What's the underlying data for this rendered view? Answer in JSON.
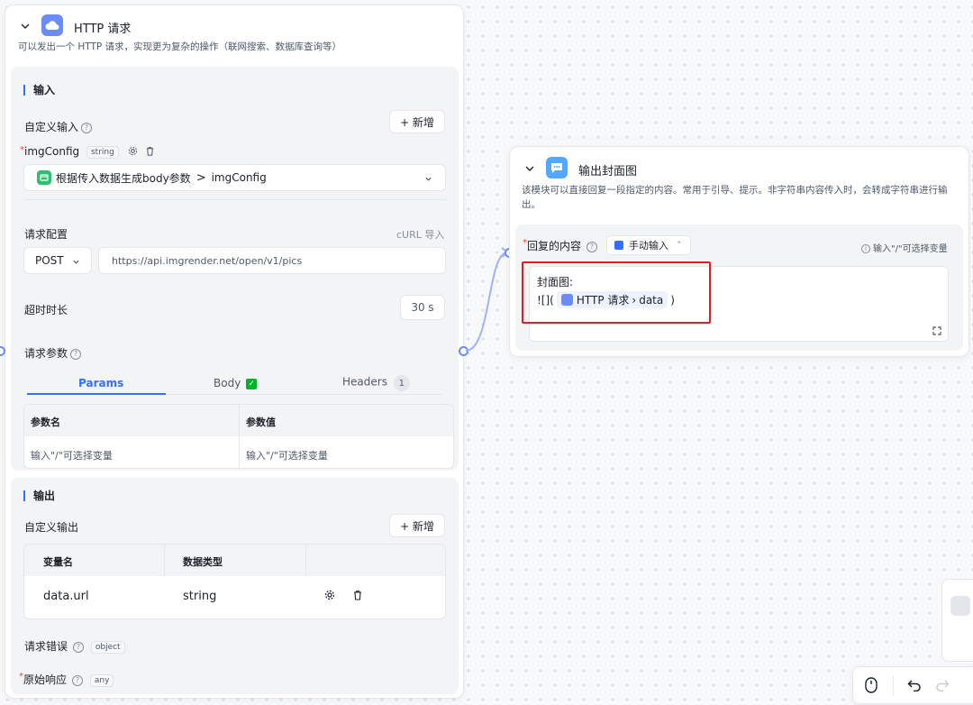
{
  "http_node": {
    "title": "HTTP 请求",
    "description": "可以发出一个 HTTP 请求，实现更为复杂的操作（联网搜索、数据库查询等）",
    "input_section": {
      "title": "输入",
      "custom_input_label": "自定义输入",
      "add_button": "+ 新增",
      "variable": {
        "name": "imgConfig",
        "type": "string"
      },
      "reference": {
        "source": "根据传入数据生成body参数",
        "separator": ">",
        "target": "imgConfig"
      }
    },
    "request_config": {
      "label": "请求配置",
      "curl_import": "cURL 导入",
      "method": "POST",
      "url": "https://api.imgrender.net/open/v1/pics"
    },
    "timeout": {
      "label": "超时时长",
      "value": "30 s"
    },
    "params": {
      "label": "请求参数",
      "tabs": [
        {
          "label": "Params",
          "active": true
        },
        {
          "label": "Body",
          "badge": "✓"
        },
        {
          "label": "Headers",
          "count": "1"
        }
      ],
      "columns": [
        "参数名",
        "参数值"
      ],
      "row": [
        "输入\"/\"可选择变量",
        "输入\"/\"可选择变量"
      ]
    },
    "output_section": {
      "title": "输出",
      "custom_output_label": "自定义输出",
      "add_button": "+ 新增",
      "columns": [
        "变量名",
        "数据类型"
      ],
      "rows": [
        {
          "name": "data.url",
          "type": "string"
        }
      ]
    },
    "error": {
      "label": "请求错误",
      "type": "object"
    },
    "raw": {
      "label": "原始响应",
      "type": "any"
    }
  },
  "output_node": {
    "title": "输出封面图",
    "description": "该模块可以直接回复一段指定的内容。常用于引导、提示。非字符串内容传入时，会转成字符串进行输出。",
    "reply_label": "回复的内容",
    "mode": "手动输入",
    "mode_arrow": "⌃",
    "var_hint": "输入\"/\"可选择变量",
    "content_line1": "封面图:",
    "content_prefix": "![](",
    "ref_node": "HTTP 请求",
    "ref_sep": "›",
    "ref_field": "data",
    "content_suffix": ")"
  },
  "colors": {
    "accent": "#3370ff",
    "icon_bg": "#6b8cf7",
    "highlight": "#e02020",
    "success": "#00b42a"
  }
}
